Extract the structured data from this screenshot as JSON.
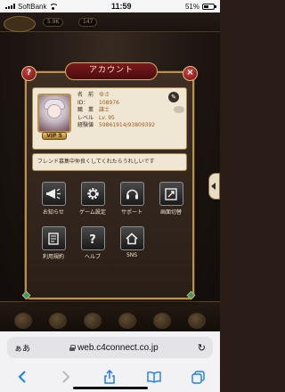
{
  "status_bar": {
    "carrier": "SoftBank",
    "time": "11:59",
    "battery": "51%"
  },
  "hud": {
    "counters": [
      "5.9K",
      "147"
    ]
  },
  "modal": {
    "title": "アカウント",
    "help_label": "?",
    "close_label": "×",
    "profile": {
      "name_label": "名　前",
      "name_value": "ゆさ",
      "id_label": "ID：",
      "id_value": "108976",
      "job_label": "職　業",
      "job_value": "謀士",
      "level_label": "レベル",
      "level_value": "Lv. 95",
      "exp_label": "経験値",
      "exp_value": "59861914/93809392",
      "vip_label": "VIP 5"
    },
    "message": "フレンド募集中仲良くしてくれたらうれしいです",
    "menu": [
      {
        "label": "お知らせ",
        "icon": "megaphone-icon"
      },
      {
        "label": "ゲーム設定",
        "icon": "gear-icon"
      },
      {
        "label": "サポート",
        "icon": "headset-icon"
      },
      {
        "label": "画面切替",
        "icon": "screen-switch-icon"
      },
      {
        "label": "利用規約",
        "icon": "scroll-icon"
      },
      {
        "label": "ヘルプ",
        "icon": "help-icon"
      },
      {
        "label": "SNS",
        "icon": "home-icon"
      }
    ]
  },
  "bottom_nav": {
    "items": [
      "",
      "",
      "",
      "",
      "",
      ""
    ]
  },
  "browser": {
    "aa_label": "ぁあ",
    "url": "web.c4connect.co.jp"
  }
}
